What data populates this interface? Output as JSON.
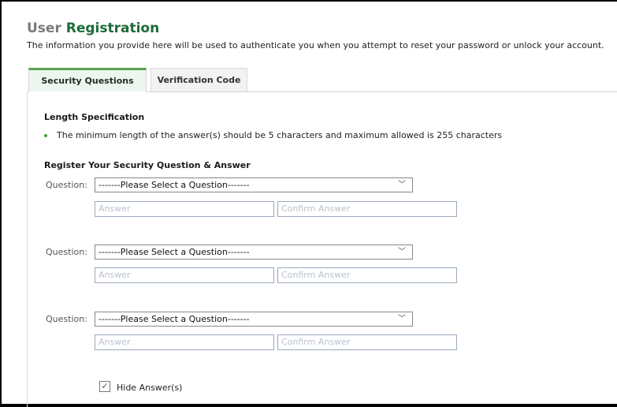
{
  "header": {
    "title_prefix": "User",
    "title_accent": "Registration",
    "subtitle": "The information you provide here will be used to authenticate you when you attempt to reset your password or unlock your account."
  },
  "tabs": [
    {
      "label": "Security Questions",
      "active": true
    },
    {
      "label": "Verification Code",
      "active": false
    }
  ],
  "length_spec": {
    "heading": "Length Specification",
    "rule": "The minimum length of the answer(s) should be 5 characters and maximum allowed is 255 characters"
  },
  "register": {
    "heading": "Register Your Security Question & Answer",
    "question_label": "Question:",
    "select_placeholder": "-------Please Select a Question-------",
    "answer_placeholder": "Answer",
    "confirm_placeholder": "Confirm Answer"
  },
  "hide_answers": {
    "label": "Hide Answer(s)",
    "checked": true
  },
  "colors": {
    "accent_green": "#1d6b3a",
    "tab_top_border": "#5aa34f",
    "bullet": "#4a9a3d"
  },
  "icons": {
    "dropdown": "chevron-down-icon",
    "checkbox": "check-icon"
  }
}
